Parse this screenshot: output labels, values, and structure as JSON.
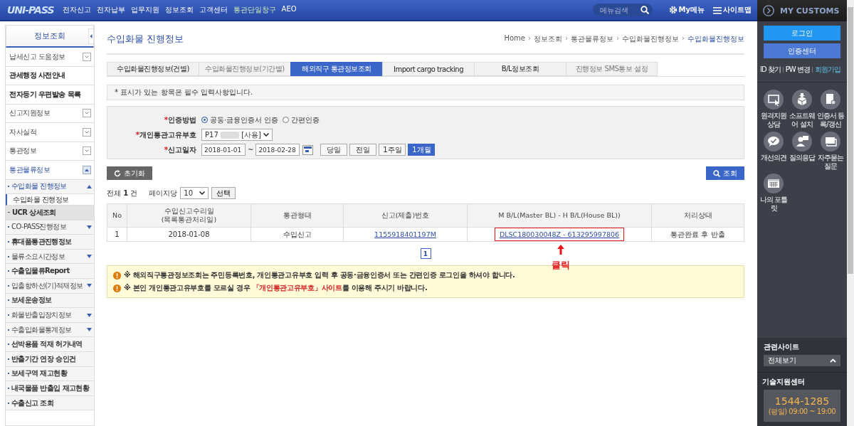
{
  "logo": {
    "text": "UNI-PASS"
  },
  "nav": [
    {
      "label": "전자신고",
      "highlight": false
    },
    {
      "label": "전자납부",
      "highlight": false
    },
    {
      "label": "업무지원",
      "highlight": false
    },
    {
      "label": "정보조회",
      "highlight": false
    },
    {
      "label": "고객센터",
      "highlight": false
    },
    {
      "label": "통관단일창구",
      "highlight": true
    },
    {
      "label": "AEO",
      "highlight": false
    }
  ],
  "search": {
    "placeholder": "메뉴검색"
  },
  "top_links": [
    {
      "kind": "gear",
      "label": "My메뉴"
    },
    {
      "kind": "menu",
      "label": "사이트맵"
    }
  ],
  "sidebar": {
    "title": "정보조회",
    "items": [
      {
        "label": "납세신고 도움정보",
        "kind": "toggle",
        "expanded": false
      },
      {
        "label": "관세행정 사전안내",
        "kind": "link"
      },
      {
        "label": "전자등기 우편발송 목록",
        "kind": "link"
      },
      {
        "label": "신고지원정보",
        "kind": "toggle",
        "expanded": false
      },
      {
        "label": "자사실적",
        "kind": "toggle",
        "expanded": false
      },
      {
        "label": "통관정보",
        "kind": "toggle",
        "expanded": false
      },
      {
        "label": "통관물류정보",
        "kind": "toggle",
        "expanded": true,
        "children": [
          {
            "label": "수입화물 진행정보",
            "kind": "group",
            "expanded": true,
            "children": [
              {
                "label": "수입화물 진행정보",
                "selected": true
              }
            ]
          },
          {
            "label": "UCR 상세조회",
            "kind": "link",
            "highlighted": true
          },
          {
            "label": "CO-PASS진행정보",
            "kind": "group",
            "expanded": false
          },
          {
            "label": "휴대품통관진행정보",
            "kind": "link",
            "highlighted": false
          },
          {
            "label": "물류소요시간정보",
            "kind": "group",
            "expanded": false
          },
          {
            "label": "수출입물류Report",
            "kind": "link",
            "highlighted": false
          },
          {
            "label": "입출항하선(기)적재정보",
            "kind": "group",
            "expanded": false
          },
          {
            "label": "보세운송정보",
            "kind": "link",
            "highlighted": false
          },
          {
            "label": "화물반출입장치정보",
            "kind": "group",
            "expanded": false
          },
          {
            "label": "수출입화물통계정보",
            "kind": "group",
            "expanded": false
          },
          {
            "label": "선박용품 적재 허가내역",
            "kind": "link",
            "highlighted": false
          },
          {
            "label": "반출기간 연장 승인건",
            "kind": "link",
            "highlighted": false
          },
          {
            "label": "보세구역 재고현황",
            "kind": "link",
            "highlighted": false
          },
          {
            "label": "내국물품 반출입 재고현황",
            "kind": "link",
            "highlighted": false
          },
          {
            "label": "수출신고 조회",
            "kind": "link",
            "highlighted": false
          }
        ]
      }
    ]
  },
  "page_title": "수입화물 진행정보",
  "breadcrumb_separator": "›",
  "breadcrumb": [
    "Home",
    "정보조회",
    "통관물류정보",
    "수입화물진행정보",
    "수입화물진행정보"
  ],
  "tabs": [
    {
      "label": "수입화물진행정보(건별)",
      "selected": false,
      "disabled": false
    },
    {
      "label": "수입화물진행정보(기간별)",
      "selected": false,
      "disabled": true
    },
    {
      "label": "해외직구 통관정보조회",
      "selected": true,
      "disabled": false
    },
    {
      "label": "Import cargo tracking",
      "selected": false,
      "disabled": false
    },
    {
      "label": "B/L정보조회",
      "selected": false,
      "disabled": false
    },
    {
      "label": "진행정보 SMS통보 설정",
      "selected": false,
      "disabled": true
    }
  ],
  "notice": "* 표시가 있는 항목은 필수 입력사항입니다.",
  "form": {
    "required_mark": "*",
    "auth": {
      "label": "인증방법",
      "options": [
        {
          "label": "공동·금융인증서 인증",
          "selected": true
        },
        {
          "label": "간편인증",
          "selected": false
        }
      ]
    },
    "customs_code": {
      "label": "개인통관고유부호",
      "value": "P17",
      "suffix": "[사용]"
    },
    "date": {
      "label": "신고일자",
      "from": "2018-01-01",
      "separator": "~",
      "to": "2018-02-28",
      "periods": [
        {
          "label": "당일",
          "selected": false
        },
        {
          "label": "전일",
          "selected": false
        },
        {
          "label": "1주일",
          "selected": false
        },
        {
          "label": "1개월",
          "selected": true
        }
      ]
    }
  },
  "reset_button": "초기화",
  "search_button": "조회",
  "results": {
    "total_label": "전체",
    "count": "1",
    "unit": "건",
    "page_size_label": "페이지당",
    "page_size": "10",
    "select_button": "선택"
  },
  "table": {
    "columns": [
      "No",
      "수입신고수리일\n(목록통관처리일)",
      "통관형태",
      "신고(제출)번호",
      "M B/L(Master BL) - H B/L(House BL))",
      "처리상태"
    ],
    "rows": [
      [
        "1",
        "2018-01-08",
        "수입신고",
        "1155918401197M",
        "DLSC180030048Z - 613295997806",
        "통관완료 후 반출"
      ]
    ]
  },
  "pagination": [
    {
      "label": "1",
      "selected": true
    }
  ],
  "annotation": "클릭",
  "warnings": [
    "※ 해외직구통관정보조회는 주민등록번호, 개인통관고유부호 입력 후 공동·금융인증서 또는 간편인증 로그인을 하셔야 합니다.",
    "※ 본인 개인통관고유부호를 모르실 경우 **「개인통관고유부호」사이트**를 이용해 주시기 바랍니다."
  ],
  "right_panel": {
    "title": "MY CUSTOMS",
    "login": "로그인",
    "cert_center": "인증센터",
    "links": [
      {
        "label": "ID 찾기",
        "highlight": false
      },
      {
        "label": "PW 변경",
        "highlight": false
      },
      {
        "label": "회원가입",
        "highlight": true
      }
    ],
    "shortcuts": [
      {
        "kind": "monitor",
        "label": "원격지원 상담"
      },
      {
        "kind": "box",
        "label": "소프트웨어 설치"
      },
      {
        "kind": "certificate",
        "label": "인증서 등록/갱신"
      },
      {
        "kind": "chat",
        "label": "개선의견"
      },
      {
        "kind": "person",
        "label": "질의응답"
      },
      {
        "kind": "cards",
        "label": "자주묻는 질문"
      },
      {
        "kind": "calendar",
        "label": "나의 포틀릿"
      }
    ],
    "related_title": "관련사이트",
    "related_select": "전체보기",
    "support_title": "기술지원센터",
    "phone": "1544-1285",
    "hours": "(평일) 09:00 ~ 19:00"
  }
}
